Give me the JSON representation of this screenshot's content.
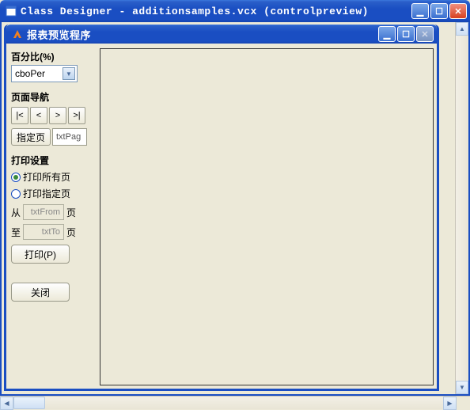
{
  "outer": {
    "title": "Class Designer - additionsamples.vcx (controlpreview)"
  },
  "inner": {
    "title": "报表预览程序"
  },
  "percent": {
    "label": "百分比(%)",
    "combo_value": "cboPer"
  },
  "nav": {
    "label": "页面导航",
    "first": "|<",
    "prev": "<",
    "next": ">",
    "last": ">|",
    "goto_label": "指定页",
    "page_value": "txtPag"
  },
  "print": {
    "label": "打印设置",
    "all_label": "打印所有页",
    "range_label": "打印指定页",
    "from_label": "从",
    "to_label": "至",
    "page_suffix": "页",
    "from_value": "txtFrom",
    "to_value": "txtTo",
    "button": "打印(P)"
  },
  "close_button": "关闭",
  "glyph": {
    "min": "▁",
    "max": "☐",
    "close": "✕",
    "dropdown": "▼",
    "up": "▲",
    "down": "▼",
    "left": "◀",
    "right": "▶"
  }
}
